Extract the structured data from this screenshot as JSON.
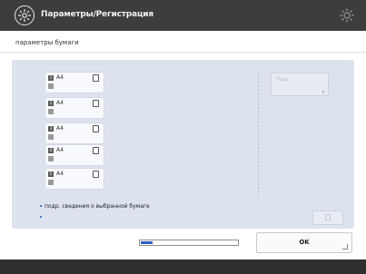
{
  "window": {
    "title": "Параметры/Регистрация",
    "subtitle": "параметры бумаги"
  },
  "trays": [
    {
      "number": "1",
      "size": "A4"
    },
    {
      "number": "2",
      "size": "A4"
    },
    {
      "number": "3",
      "size": "A4"
    },
    {
      "number": "4",
      "size": "A4"
    },
    {
      "number": "5",
      "size": "A4"
    }
  ],
  "details_button": {
    "label": "Подр..."
  },
  "notice": {
    "text": "подр. сведения о выбранной бумаге"
  },
  "progress": {
    "percent": 12
  },
  "ok_button": {
    "label": "OK"
  },
  "colors": {
    "accent": "#2a63c5",
    "titlebar": "#3d3d3d",
    "panel": "#dde2ef"
  },
  "icons": [
    "settings-app-icon",
    "gear-icon",
    "tray-paper-icon",
    "chevron-right-icon"
  ]
}
